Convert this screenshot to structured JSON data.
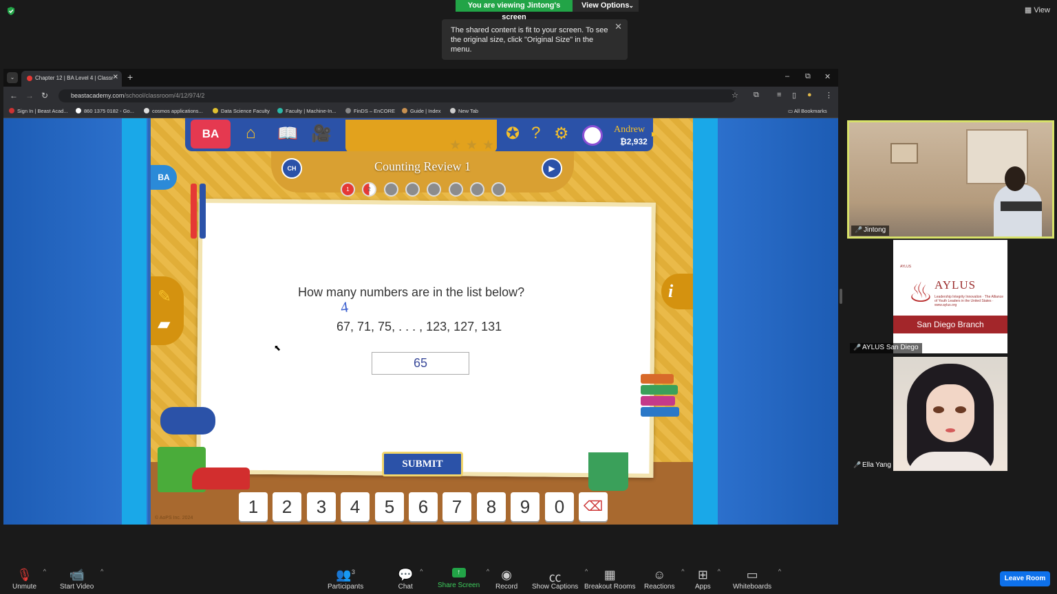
{
  "zoom": {
    "viewing_banner": "You are viewing Jintong's screen",
    "view_options": "View Options",
    "tooltip": "The shared content is fit to your screen. To see the original size, click \"Original Size\" in the menu.",
    "view_button": "View",
    "participants_tiles": [
      {
        "name": "Jintong",
        "muted": true
      },
      {
        "name": "AYLUS San Diego",
        "muted": true
      },
      {
        "name": "Ella Yang",
        "muted": true
      }
    ],
    "aylus_slide": {
      "mini_label": "AYLUS",
      "name": "AYLUS",
      "tagline": "Leadership Integrity Innovation · The Alliance of Youth Leaders in the United States · www.aylus.org",
      "branch": "San Diego Branch"
    },
    "toolbar": {
      "unmute": "Unmute",
      "start_video": "Start Video",
      "participants": "Participants",
      "participants_count": "3",
      "chat": "Chat",
      "share_screen": "Share Screen",
      "record": "Record",
      "show_captions": "Show Captions",
      "breakout_rooms": "Breakout Rooms",
      "reactions": "Reactions",
      "apps": "Apps",
      "whiteboards": "Whiteboards",
      "leave_room": "Leave Room"
    }
  },
  "browser": {
    "tab_title": "Chapter 12 | BA Level 4 | Classr",
    "url_host": "beastacademy.com",
    "url_path": "/school/classroom/4/12/974/2",
    "bookmarks": [
      "Sign In | Beast Acad...",
      "860 1375 0182 - Go...",
      "cosmos applications...",
      "Data Science Faculty",
      "Faculty | Machine-In...",
      "FinDS – EnCORE",
      "Guide | Index",
      "New Tab"
    ],
    "all_bookmarks": "All Bookmarks"
  },
  "game": {
    "logo": "BA",
    "side_logo": "BA",
    "user_name": "Andrew",
    "coins": "₿2,932",
    "chapter_badge": "CH",
    "title": "Counting Review 1",
    "progress_dots": [
      "1",
      "2",
      "",
      "",
      "",
      "",
      "",
      ""
    ],
    "question": "How many numbers are in the list below?",
    "sequence": "67, 71, 75, . . . , 123, 127, 131",
    "scribble": "4",
    "answer_value": "65",
    "submit": "SUBMIT",
    "keypad": [
      "1",
      "2",
      "3",
      "4",
      "5",
      "6",
      "7",
      "8",
      "9",
      "0"
    ],
    "copyright": "© AoPS Inc. 2024"
  },
  "colors": {
    "zoom_green": "#22a447",
    "leave_blue": "#0e71eb",
    "ba_blue": "#2b52a8",
    "ba_gold": "#e8b43a",
    "ba_red": "#e53950",
    "speaker_border": "#d8e26a"
  }
}
